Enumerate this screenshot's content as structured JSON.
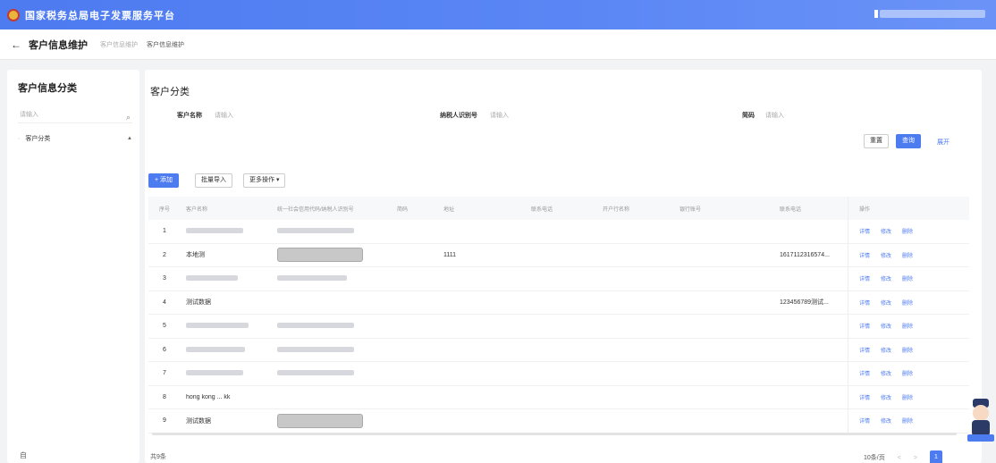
{
  "header": {
    "title": "国家税务总局电子发票服务平台"
  },
  "breadcrumb": {
    "page_title": "客户信息维护",
    "parent": "客户信息维护",
    "current": "客户信息维护"
  },
  "sidebar": {
    "title": "客户信息分类",
    "search_placeholder": "请输入",
    "tree_item": "客户分类",
    "footer": "自"
  },
  "main": {
    "title": "客户分类",
    "filters": [
      {
        "label": "客户名称",
        "placeholder": "请输入"
      },
      {
        "label": "纳税人识别号",
        "placeholder": "请输入"
      },
      {
        "label": "简码",
        "placeholder": "请输入"
      }
    ],
    "reset_label": "重置",
    "query_label": "查询",
    "expand_label": "展开",
    "add_label": "+ 添加",
    "import_label": "批量导入",
    "more_label": "更多操作 ▾"
  },
  "table": {
    "headers": [
      "序号",
      "客户名称",
      "统一社会信用代码/纳税人识别号",
      "简码",
      "地址",
      "联系电话",
      "开户行名称",
      "银行账号",
      "联系电话",
      "操作"
    ],
    "rows": [
      {
        "no": "1",
        "name": "",
        "code": "",
        "addr": "",
        "phone": ""
      },
      {
        "no": "2",
        "name": "本地测",
        "code": "",
        "addr": "1111",
        "phone": "1617112316574..."
      },
      {
        "no": "3",
        "name": "",
        "code": "",
        "addr": "",
        "phone": ""
      },
      {
        "no": "4",
        "name": "测试数据",
        "code": "",
        "addr": "",
        "phone": "123456789测试..."
      },
      {
        "no": "5",
        "name": "",
        "code": "",
        "addr": "",
        "phone": ""
      },
      {
        "no": "6",
        "name": "",
        "code": "",
        "addr": "",
        "phone": ""
      },
      {
        "no": "7",
        "name": "",
        "code": "",
        "addr": "",
        "phone": ""
      },
      {
        "no": "8",
        "name": "hong kong ... kk",
        "code": "",
        "addr": "",
        "phone": ""
      },
      {
        "no": "9",
        "name": "测试数据",
        "code": "",
        "addr": "",
        "phone": ""
      }
    ],
    "actions": [
      "详情",
      "修改",
      "删除"
    ]
  },
  "footer": {
    "total": "共9条",
    "page_size": "10条/页",
    "prev": "<",
    "next": ">",
    "page": "1"
  },
  "colors": {
    "primary": "#4d7bf0",
    "header_bg": "#5b87f5"
  }
}
